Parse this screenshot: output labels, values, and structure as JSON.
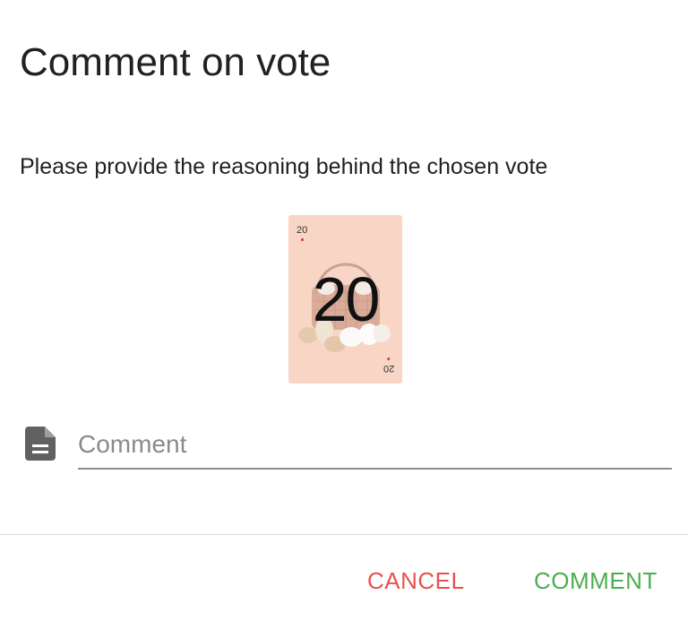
{
  "dialog": {
    "title": "Comment on vote",
    "subtitle": "Please provide the reasoning behind the chosen vote"
  },
  "card": {
    "value": "20",
    "corner_top": "20",
    "corner_bottom": "20",
    "background_color": "#f9d5c6",
    "pip_color": "#d23b2b",
    "art_icon": "basket-of-eggs-icon"
  },
  "comment_field": {
    "icon": "document-icon",
    "placeholder": "Comment",
    "value": ""
  },
  "actions": {
    "cancel_label": "CANCEL",
    "comment_label": "COMMENT",
    "cancel_color": "#e8524e",
    "comment_color": "#4cae4f"
  }
}
